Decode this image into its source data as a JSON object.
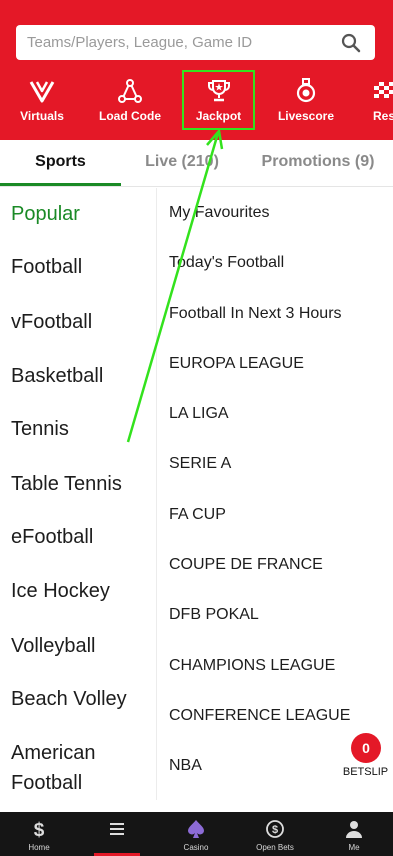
{
  "search": {
    "placeholder": "Teams/Players, League, Game ID"
  },
  "nav": {
    "items": [
      {
        "label": "Virtuals",
        "icon": "virtuals-icon"
      },
      {
        "label": "Load Code",
        "icon": "load-code-icon"
      },
      {
        "label": "Jackpot",
        "icon": "trophy-icon"
      },
      {
        "label": "Livescore",
        "icon": "medal-icon"
      },
      {
        "label": "Res",
        "icon": "checkered-flag-icon"
      }
    ]
  },
  "tabs": [
    {
      "label": "Sports"
    },
    {
      "label": "Live (210)"
    },
    {
      "label": "Promotions (9)"
    }
  ],
  "sports": [
    "Popular",
    "Football",
    "vFootball",
    "Basketball",
    "Tennis",
    "Table Tennis",
    "eFootball",
    "Ice Hockey",
    "Volleyball",
    "Beach Volley",
    "American",
    "Football"
  ],
  "competitions": [
    "My Favourites",
    "Today's Football",
    "Football In Next 3 Hours",
    "EUROPA LEAGUE",
    "LA LIGA",
    "SERIE A",
    "FA CUP",
    "COUPE DE FRANCE",
    "DFB POKAL",
    "CHAMPIONS LEAGUE",
    "CONFERENCE LEAGUE",
    "NBA"
  ],
  "betslip": {
    "count": "0",
    "label": "BETSLIP"
  },
  "bottom_nav": [
    {
      "label": "Home",
      "icon": "home-icon"
    },
    {
      "label": "",
      "icon": "menu-icon"
    },
    {
      "label": "Casino",
      "icon": "spade-icon"
    },
    {
      "label": "Open Bets",
      "icon": "open-bets-icon"
    },
    {
      "label": "Me",
      "icon": "user-icon"
    }
  ],
  "colors": {
    "brand_red": "#e41827",
    "active_green": "#1a8a26",
    "highlight": "#33e21d"
  }
}
